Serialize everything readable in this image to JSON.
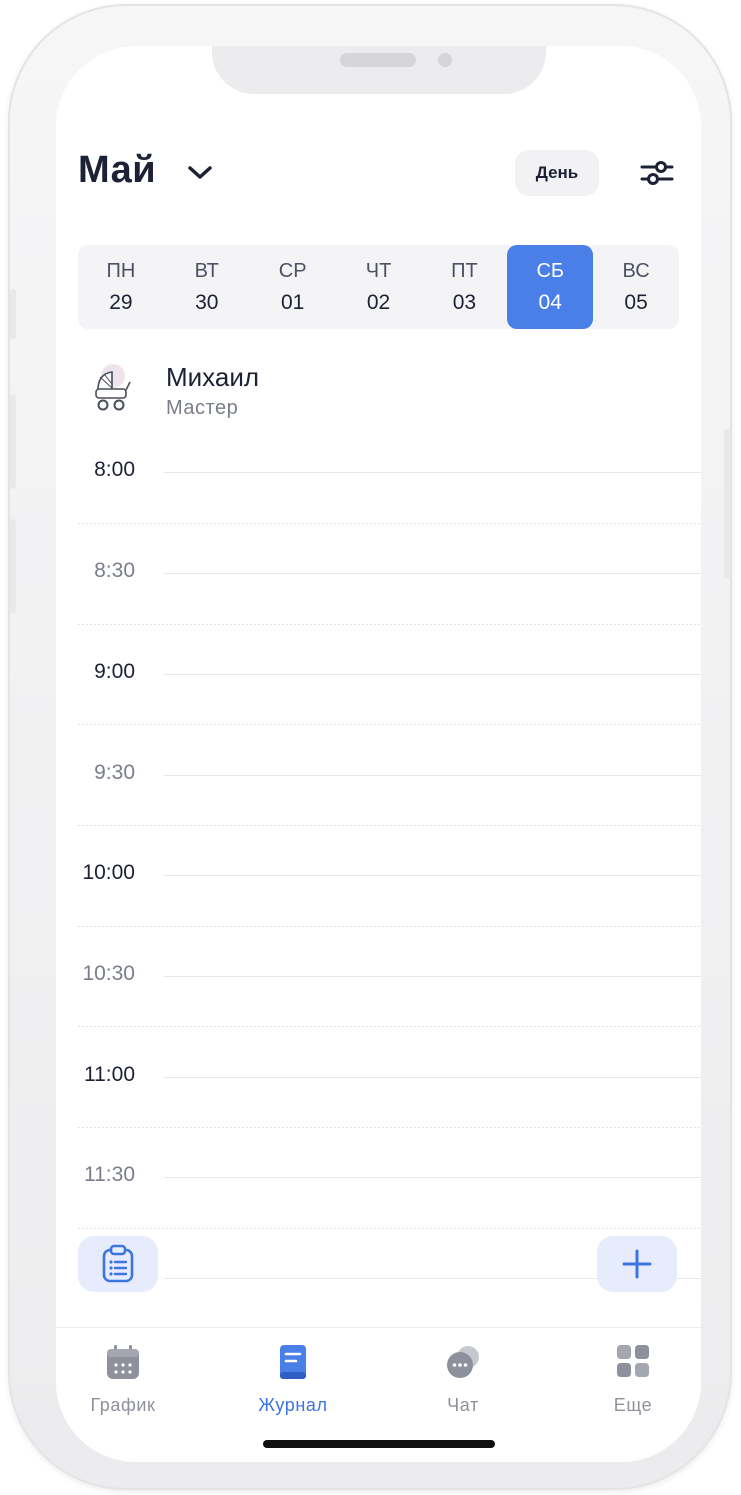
{
  "header": {
    "month": "Май",
    "view_mode": "День"
  },
  "week": [
    {
      "name": "ПН",
      "num": "29",
      "selected": false
    },
    {
      "name": "ВТ",
      "num": "30",
      "selected": false
    },
    {
      "name": "СР",
      "num": "01",
      "selected": false
    },
    {
      "name": "ЧТ",
      "num": "02",
      "selected": false
    },
    {
      "name": "ПТ",
      "num": "03",
      "selected": false
    },
    {
      "name": "СБ",
      "num": "04",
      "selected": true
    },
    {
      "name": "ВС",
      "num": "05",
      "selected": false
    }
  ],
  "staff": {
    "name": "Михаил",
    "role": "Мастер"
  },
  "timeline": {
    "slots": [
      "8:00",
      "8:30",
      "9:00",
      "9:30",
      "10:00",
      "10:30",
      "11:00",
      "11:30"
    ]
  },
  "tabs": [
    {
      "label": "График",
      "icon": "calendar-icon",
      "active": false
    },
    {
      "label": "Журнал",
      "icon": "journal-icon",
      "active": true
    },
    {
      "label": "Чат",
      "icon": "chat-icon",
      "active": false
    },
    {
      "label": "Еще",
      "icon": "grid-icon",
      "active": false
    }
  ],
  "colors": {
    "accent": "#4a7fe8",
    "title": "#1d2135",
    "muted": "#7a7e8c"
  }
}
